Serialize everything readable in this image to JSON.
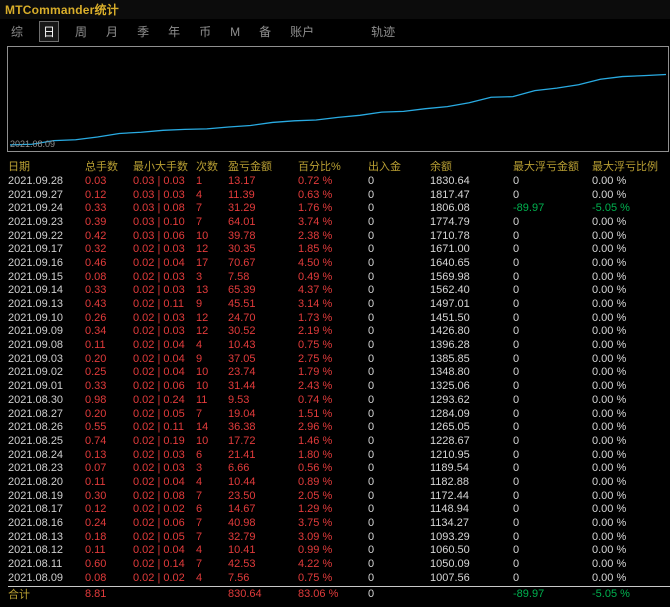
{
  "window": {
    "title": "MTCommander统计"
  },
  "colors": {
    "red": "#e23b3b",
    "green": "#00b14f",
    "gold": "#b99f33",
    "line": "#29abe2"
  },
  "tabs": {
    "items": [
      {
        "label": "综",
        "active": false
      },
      {
        "label": "日",
        "active": true
      },
      {
        "label": "周",
        "active": false
      },
      {
        "label": "月",
        "active": false
      },
      {
        "label": "季",
        "active": false
      },
      {
        "label": "年",
        "active": false
      },
      {
        "label": "币",
        "active": false
      },
      {
        "label": "M",
        "active": false
      },
      {
        "label": "备",
        "active": false
      },
      {
        "label": "账户",
        "active": false
      },
      {
        "label": "轨迹",
        "active": false,
        "gap": true
      }
    ]
  },
  "chart": {
    "origin_label": "2021.08.09",
    "line_color": "#29abe2"
  },
  "chart_data": {
    "type": "line",
    "title": "账户余额曲线",
    "start_value": 1000.0,
    "x": [
      "2021.08.09",
      "2021.08.11",
      "2021.08.12",
      "2021.08.13",
      "2021.08.16",
      "2021.08.17",
      "2021.08.19",
      "2021.08.20",
      "2021.08.23",
      "2021.08.24",
      "2021.08.25",
      "2021.08.26",
      "2021.08.27",
      "2021.08.30",
      "2021.09.01",
      "2021.09.02",
      "2021.09.03",
      "2021.09.08",
      "2021.09.09",
      "2021.09.10",
      "2021.09.13",
      "2021.09.14",
      "2021.09.15",
      "2021.09.16",
      "2021.09.17",
      "2021.09.22",
      "2021.09.23",
      "2021.09.24",
      "2021.09.27",
      "2021.09.28"
    ],
    "values": [
      1007.56,
      1050.09,
      1060.5,
      1093.29,
      1134.27,
      1148.94,
      1172.44,
      1182.88,
      1189.54,
      1210.95,
      1228.67,
      1265.05,
      1284.09,
      1293.62,
      1325.06,
      1348.8,
      1385.85,
      1396.28,
      1426.8,
      1451.5,
      1497.01,
      1562.4,
      1569.98,
      1640.65,
      1671.0,
      1710.78,
      1774.79,
      1806.08,
      1817.47,
      1830.64
    ],
    "ylim": [
      1000,
      1830.64
    ],
    "grid": false,
    "legend": "none"
  },
  "table": {
    "headers": [
      "日期",
      "总手数",
      "最小大手数",
      "次数",
      "盈亏金额",
      "百分比%",
      "出入金",
      "余额",
      "最大浮亏金额",
      "最大浮亏比例"
    ],
    "rows": [
      [
        "2021.09.28",
        "0.03",
        "0.03 | 0.03",
        "1",
        "13.17",
        "0.72 %",
        "0",
        "1830.64",
        "0",
        "0.00 %"
      ],
      [
        "2021.09.27",
        "0.12",
        "0.03 | 0.03",
        "4",
        "11.39",
        "0.63 %",
        "0",
        "1817.47",
        "0",
        "0.00 %"
      ],
      [
        "2021.09.24",
        "0.33",
        "0.03 | 0.08",
        "7",
        "31.29",
        "1.76 %",
        "0",
        "1806.08",
        "-89.97",
        "-5.05 %"
      ],
      [
        "2021.09.23",
        "0.39",
        "0.03 | 0.10",
        "7",
        "64.01",
        "3.74 %",
        "0",
        "1774.79",
        "0",
        "0.00 %"
      ],
      [
        "2021.09.22",
        "0.42",
        "0.03 | 0.06",
        "10",
        "39.78",
        "2.38 %",
        "0",
        "1710.78",
        "0",
        "0.00 %"
      ],
      [
        "2021.09.17",
        "0.32",
        "0.02 | 0.03",
        "12",
        "30.35",
        "1.85 %",
        "0",
        "1671.00",
        "0",
        "0.00 %"
      ],
      [
        "2021.09.16",
        "0.46",
        "0.02 | 0.04",
        "17",
        "70.67",
        "4.50 %",
        "0",
        "1640.65",
        "0",
        "0.00 %"
      ],
      [
        "2021.09.15",
        "0.08",
        "0.02 | 0.03",
        "3",
        "7.58",
        "0.49 %",
        "0",
        "1569.98",
        "0",
        "0.00 %"
      ],
      [
        "2021.09.14",
        "0.33",
        "0.02 | 0.03",
        "13",
        "65.39",
        "4.37 %",
        "0",
        "1562.40",
        "0",
        "0.00 %"
      ],
      [
        "2021.09.13",
        "0.43",
        "0.02 | 0.11",
        "9",
        "45.51",
        "3.14 %",
        "0",
        "1497.01",
        "0",
        "0.00 %"
      ],
      [
        "2021.09.10",
        "0.26",
        "0.02 | 0.03",
        "12",
        "24.70",
        "1.73 %",
        "0",
        "1451.50",
        "0",
        "0.00 %"
      ],
      [
        "2021.09.09",
        "0.34",
        "0.02 | 0.03",
        "12",
        "30.52",
        "2.19 %",
        "0",
        "1426.80",
        "0",
        "0.00 %"
      ],
      [
        "2021.09.08",
        "0.11",
        "0.02 | 0.04",
        "4",
        "10.43",
        "0.75 %",
        "0",
        "1396.28",
        "0",
        "0.00 %"
      ],
      [
        "2021.09.03",
        "0.20",
        "0.02 | 0.04",
        "9",
        "37.05",
        "2.75 %",
        "0",
        "1385.85",
        "0",
        "0.00 %"
      ],
      [
        "2021.09.02",
        "0.25",
        "0.02 | 0.04",
        "10",
        "23.74",
        "1.79 %",
        "0",
        "1348.80",
        "0",
        "0.00 %"
      ],
      [
        "2021.09.01",
        "0.33",
        "0.02 | 0.06",
        "10",
        "31.44",
        "2.43 %",
        "0",
        "1325.06",
        "0",
        "0.00 %"
      ],
      [
        "2021.08.30",
        "0.98",
        "0.02 | 0.24",
        "11",
        "9.53",
        "0.74 %",
        "0",
        "1293.62",
        "0",
        "0.00 %"
      ],
      [
        "2021.08.27",
        "0.20",
        "0.02 | 0.05",
        "7",
        "19.04",
        "1.51 %",
        "0",
        "1284.09",
        "0",
        "0.00 %"
      ],
      [
        "2021.08.26",
        "0.55",
        "0.02 | 0.11",
        "14",
        "36.38",
        "2.96 %",
        "0",
        "1265.05",
        "0",
        "0.00 %"
      ],
      [
        "2021.08.25",
        "0.74",
        "0.02 | 0.19",
        "10",
        "17.72",
        "1.46 %",
        "0",
        "1228.67",
        "0",
        "0.00 %"
      ],
      [
        "2021.08.24",
        "0.13",
        "0.02 | 0.03",
        "6",
        "21.41",
        "1.80 %",
        "0",
        "1210.95",
        "0",
        "0.00 %"
      ],
      [
        "2021.08.23",
        "0.07",
        "0.02 | 0.03",
        "3",
        "6.66",
        "0.56 %",
        "0",
        "1189.54",
        "0",
        "0.00 %"
      ],
      [
        "2021.08.20",
        "0.11",
        "0.02 | 0.04",
        "4",
        "10.44",
        "0.89 %",
        "0",
        "1182.88",
        "0",
        "0.00 %"
      ],
      [
        "2021.08.19",
        "0.30",
        "0.02 | 0.08",
        "7",
        "23.50",
        "2.05 %",
        "0",
        "1172.44",
        "0",
        "0.00 %"
      ],
      [
        "2021.08.17",
        "0.12",
        "0.02 | 0.02",
        "6",
        "14.67",
        "1.29 %",
        "0",
        "1148.94",
        "0",
        "0.00 %"
      ],
      [
        "2021.08.16",
        "0.24",
        "0.02 | 0.06",
        "7",
        "40.98",
        "3.75 %",
        "0",
        "1134.27",
        "0",
        "0.00 %"
      ],
      [
        "2021.08.13",
        "0.18",
        "0.02 | 0.05",
        "7",
        "32.79",
        "3.09 %",
        "0",
        "1093.29",
        "0",
        "0.00 %"
      ],
      [
        "2021.08.12",
        "0.11",
        "0.02 | 0.04",
        "4",
        "10.41",
        "0.99 %",
        "0",
        "1060.50",
        "0",
        "0.00 %"
      ],
      [
        "2021.08.11",
        "0.60",
        "0.02 | 0.14",
        "7",
        "42.53",
        "4.22 %",
        "0",
        "1050.09",
        "0",
        "0.00 %"
      ],
      [
        "2021.08.09",
        "0.08",
        "0.02 | 0.02",
        "4",
        "7.56",
        "0.75 %",
        "0",
        "1007.56",
        "0",
        "0.00 %"
      ]
    ],
    "footer": [
      "合计",
      "8.81",
      "",
      "",
      "830.64",
      "83.06 %",
      "0",
      "",
      "-89.97",
      "-5.05 %"
    ]
  }
}
